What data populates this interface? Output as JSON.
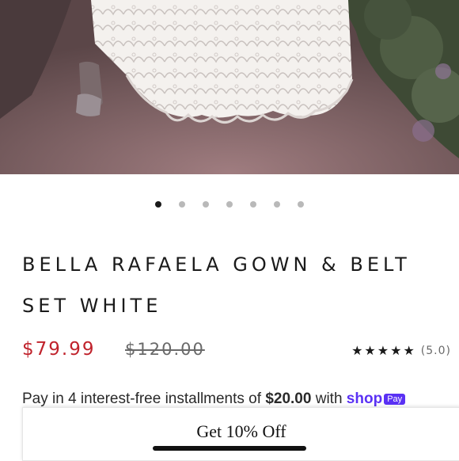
{
  "gallery": {
    "image_description_icon": "photo-icon",
    "dot_count": 7,
    "active_index": 0
  },
  "product": {
    "title": "BELLA RAFAELA GOWN & BELT SET WHITE",
    "price": "$79.99",
    "compare_price": "$120.00",
    "rating_stars": "★★★★★",
    "rating_value": "(5.0)",
    "price_color": "#c0232c"
  },
  "installments": {
    "prefix": "Pay in 4 interest-free installments of",
    "amount": "$20.00",
    "suffix": "with",
    "provider": "shop",
    "provider_badge": "Pay",
    "brand_color": "#5a31f4"
  },
  "offer": {
    "label": "Get 10% Off"
  }
}
